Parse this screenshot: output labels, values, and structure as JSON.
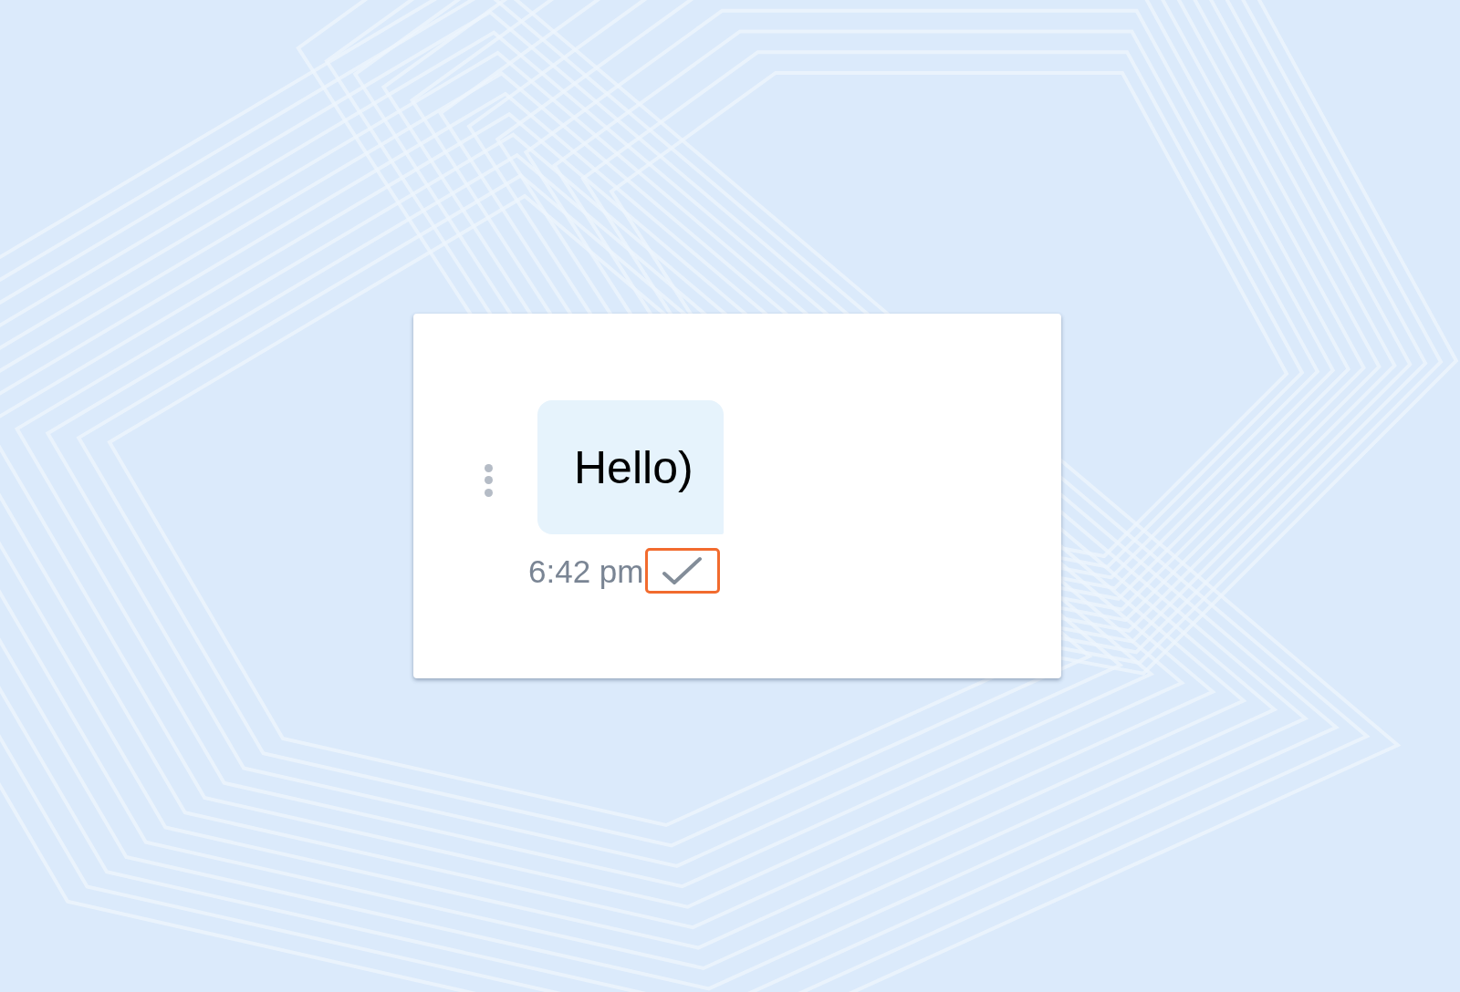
{
  "message": {
    "text": "Hello)",
    "time": "6:42 pm",
    "status_icon": {
      "kind": "single-check",
      "highlighted": true
    }
  }
}
